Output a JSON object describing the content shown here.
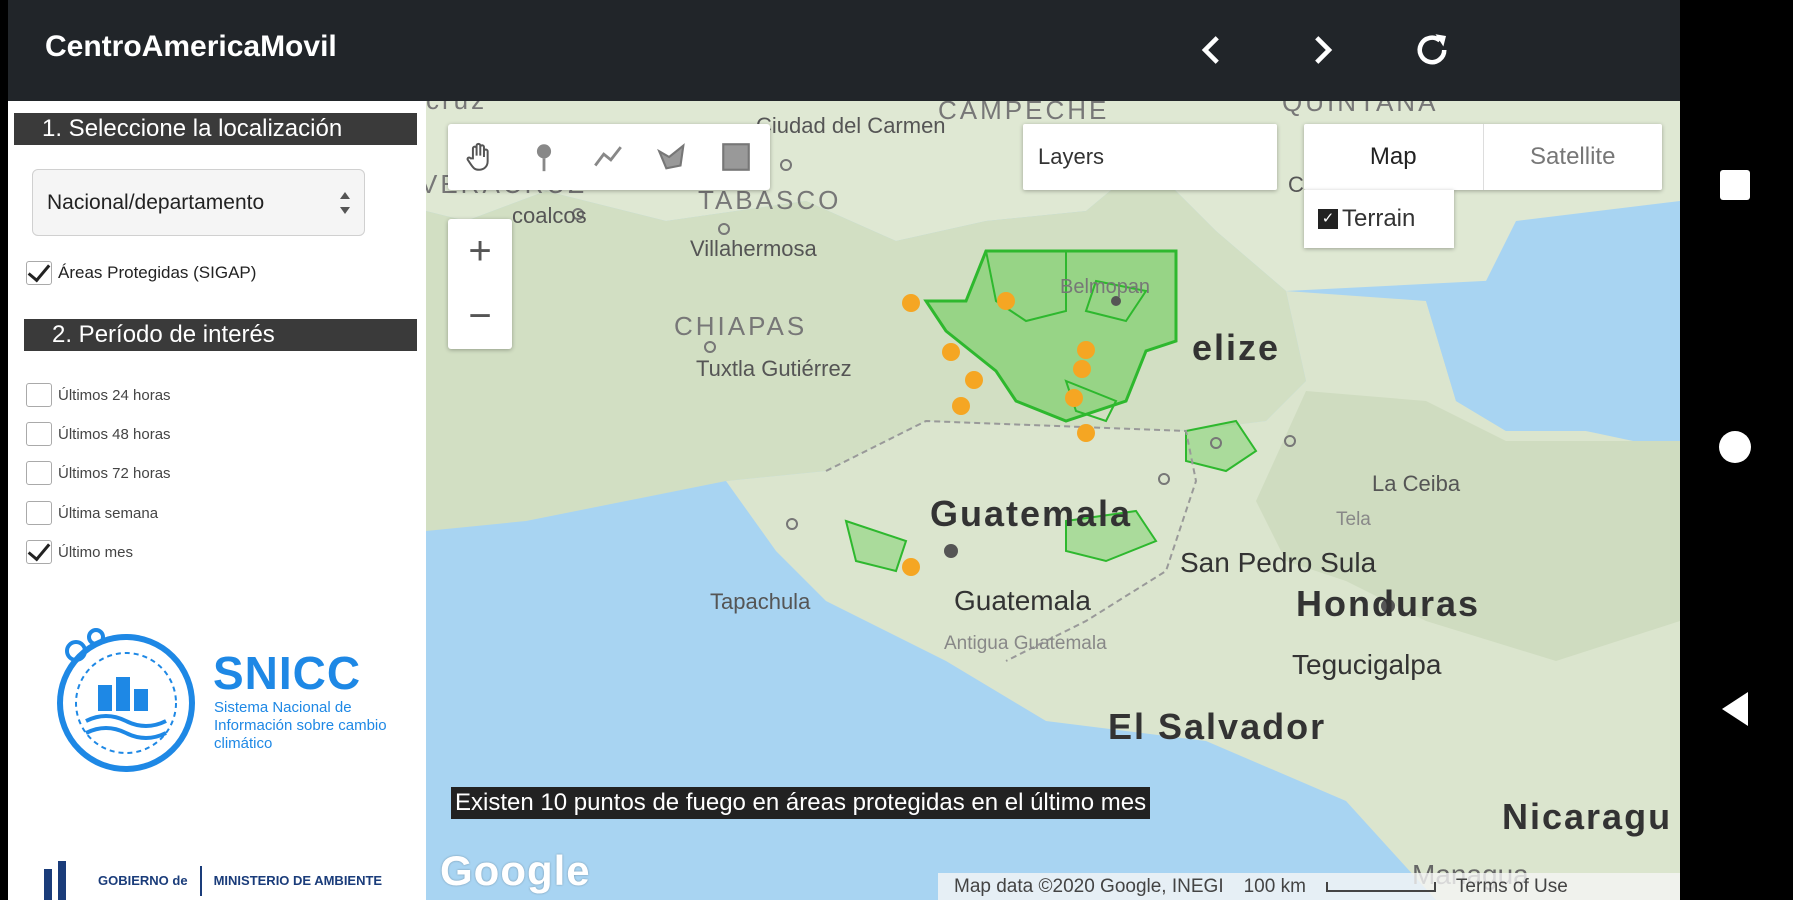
{
  "app": {
    "title": "CentroAmericaMovil"
  },
  "toolbar": {
    "back_icon": "chevron-left-icon",
    "forward_icon": "chevron-right-icon",
    "reload_icon": "refresh-icon"
  },
  "sidebar": {
    "section1": "1. Seleccione la localización",
    "location_select": "Nacional/departamento",
    "protected_areas": {
      "label": "Áreas Protegidas (SIGAP)",
      "checked": true
    },
    "section2": "2. Período de interés",
    "periods": [
      {
        "label": "Últimos 24 horas",
        "checked": false
      },
      {
        "label": "Últimos 48 horas",
        "checked": false
      },
      {
        "label": "Últimos 72 horas",
        "checked": false
      },
      {
        "label": "Última semana",
        "checked": false
      },
      {
        "label": "Último mes",
        "checked": true
      }
    ],
    "snicc": {
      "title": "SNICC",
      "subtitle": "Sistema Nacional de Información sobre cambio climático"
    },
    "gov": {
      "left": "GOBIERNO de",
      "right": "MINISTERIO DE AMBIENTE"
    }
  },
  "map": {
    "layers_label": "Layers",
    "maptype": {
      "map": "Map",
      "satellite": "Satellite"
    },
    "terrain_label": "Terrain",
    "zoom_in": "+",
    "zoom_out": "−",
    "fire_message": "Existen 10 puntos de fuego en áreas protegidas en el último mes",
    "google": "Google",
    "footer": {
      "data": "Map data ©2020 Google, INEGI",
      "scale": "100 km",
      "terms": "Terms of Use"
    },
    "labels": {
      "campeche": "CAMPECHE",
      "quintana": "QUINTANA",
      "veracruz": "VERACRUZ",
      "tabasco": "TABASCO",
      "chiapas": "CHIAPAS",
      "ciudad_carmen": "Ciudad del Carmen",
      "coatzacoalcos": "coalcos",
      "villahermosa": "Villahermosa",
      "tuxtla": "Tuxtla Gutiérrez",
      "tapachula": "Tapachula",
      "belmopan": "Belmopan",
      "belize": "elize",
      "guatemala_country": "Guatemala",
      "guatemala_city": "Guatemala",
      "antigua": "Antigua Guatemala",
      "la_ceiba": "La Ceiba",
      "tela": "Tela",
      "san_pedro_sula": "San Pedro Sula",
      "honduras": "Honduras",
      "tegucigalpa": "Tegucigalpa",
      "el_salvador": "El Salvador",
      "nicaragua": "Nicaragu",
      "managua": "Managua",
      "cruz": "cruz",
      "ch": "Ch"
    }
  },
  "colors": {
    "accent": "#1e88e5",
    "appbar": "#212529",
    "protected": "#2eb82e",
    "fire": "#f5a623"
  }
}
